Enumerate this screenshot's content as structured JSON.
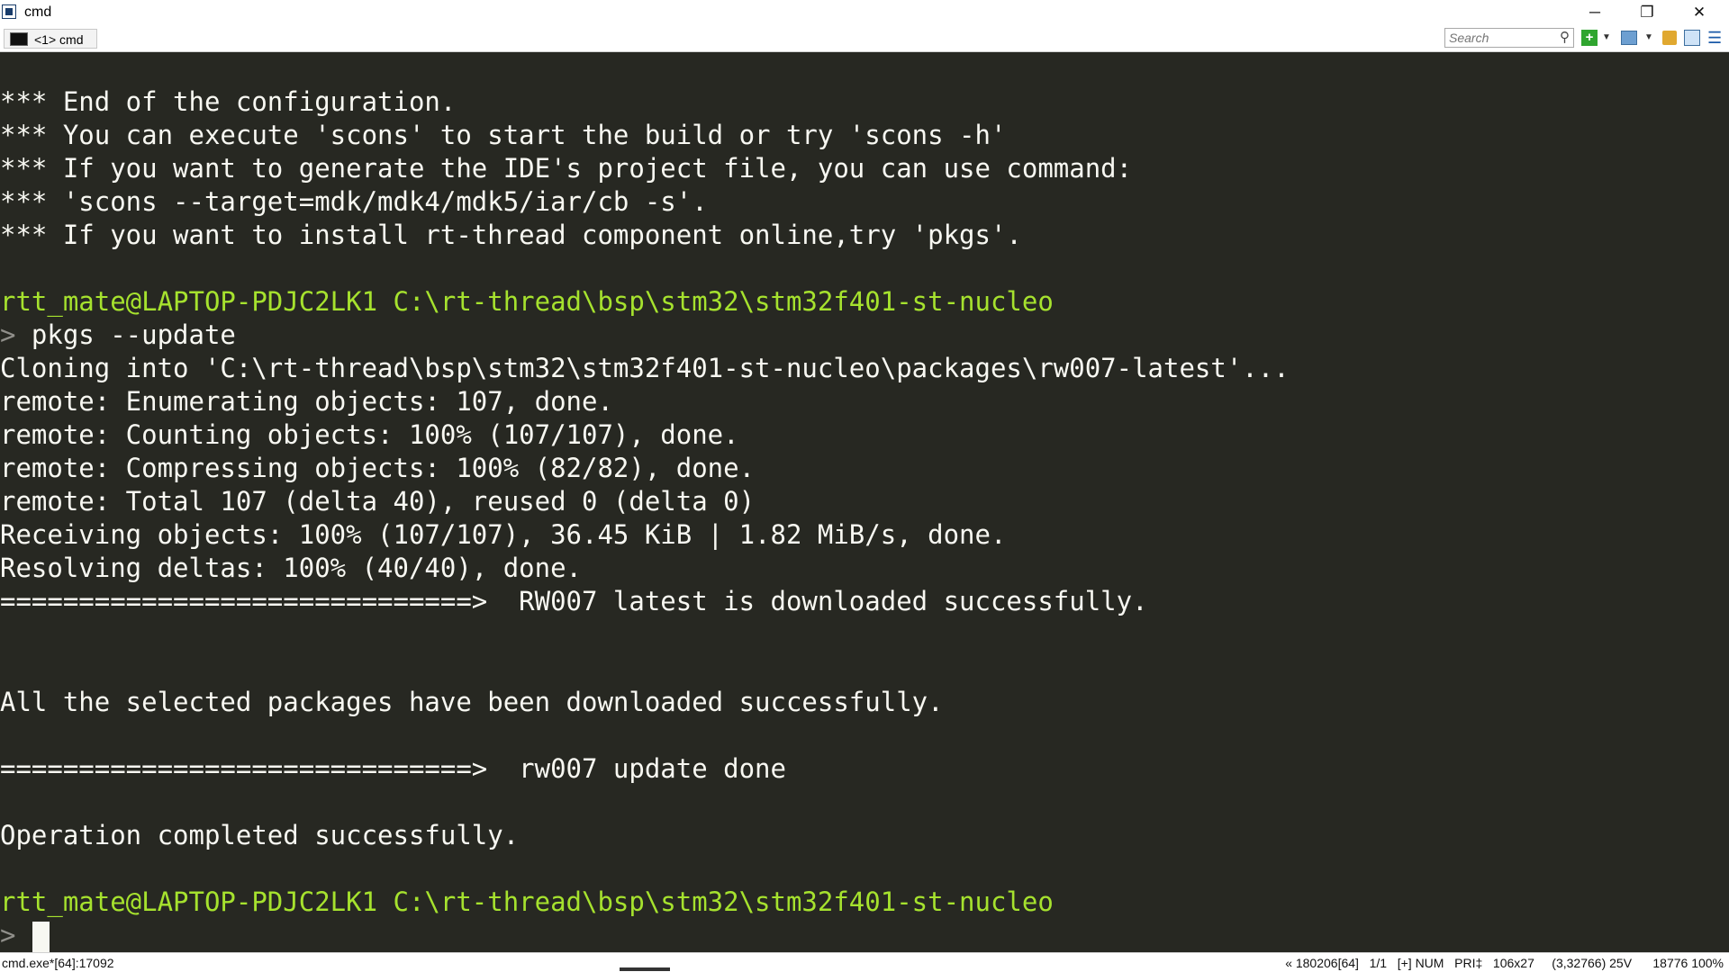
{
  "window": {
    "title": "cmd",
    "controls": {
      "minimize": "─",
      "maximize": "❐",
      "close": "✕"
    }
  },
  "tabs": [
    {
      "label": "<1> cmd"
    }
  ],
  "toolbar": {
    "search_placeholder": "Search",
    "search_icon": "⚲",
    "new_console": "+",
    "dropdown": "▼",
    "menu": "☰"
  },
  "terminal": {
    "lines": [
      {
        "text": "",
        "color": "default"
      },
      {
        "text": "*** End of the configuration.",
        "color": "default"
      },
      {
        "text": "*** You can execute 'scons' to start the build or try 'scons -h'",
        "color": "default"
      },
      {
        "text": "*** If you want to generate the IDE's project file, you can use command:",
        "color": "default"
      },
      {
        "text": "*** 'scons --target=mdk/mdk4/mdk5/iar/cb -s'.",
        "color": "default"
      },
      {
        "text": "*** If you want to install rt-thread component online,try 'pkgs'.",
        "color": "default"
      },
      {
        "text": "",
        "color": "default"
      },
      {
        "text": "rtt_mate@LAPTOP-PDJC2LK1 C:\\rt-thread\\bsp\\stm32\\stm32f401-st-nucleo",
        "color": "green"
      },
      {
        "prompt": "> ",
        "text": "pkgs --update",
        "color": "default"
      },
      {
        "text": "Cloning into 'C:\\rt-thread\\bsp\\stm32\\stm32f401-st-nucleo\\packages\\rw007-latest'...",
        "color": "default"
      },
      {
        "text": "remote: Enumerating objects: 107, done.",
        "color": "default"
      },
      {
        "text": "remote: Counting objects: 100% (107/107), done.",
        "color": "default"
      },
      {
        "text": "remote: Compressing objects: 100% (82/82), done.",
        "color": "default"
      },
      {
        "text": "remote: Total 107 (delta 40), reused 0 (delta 0)",
        "color": "default"
      },
      {
        "text": "Receiving objects: 100% (107/107), 36.45 KiB | 1.82 MiB/s, done.",
        "color": "default"
      },
      {
        "text": "Resolving deltas: 100% (40/40), done.",
        "color": "default"
      },
      {
        "text": "==============================>  RW007 latest is downloaded successfully.",
        "color": "default"
      },
      {
        "text": "",
        "color": "default"
      },
      {
        "text": "",
        "color": "default"
      },
      {
        "text": "All the selected packages have been downloaded successfully.",
        "color": "default"
      },
      {
        "text": "",
        "color": "default"
      },
      {
        "text": "==============================>  rw007 update done",
        "color": "default"
      },
      {
        "text": "",
        "color": "default"
      },
      {
        "text": "Operation completed successfully.",
        "color": "default"
      },
      {
        "text": "",
        "color": "default"
      },
      {
        "text": "rtt_mate@LAPTOP-PDJC2LK1 C:\\rt-thread\\bsp\\stm32\\stm32f401-st-nucleo",
        "color": "green"
      },
      {
        "prompt": ">",
        "text": "",
        "color": "default"
      }
    ]
  },
  "statusbar": {
    "left": "cmd.exe*[64]:17092",
    "right": "« 180206[64]   1/1   [+] NUM   PRI‡   106x27     (3,32766) 25V      18776 100%"
  },
  "colors": {
    "background": "#272822",
    "foreground": "#f8f8f2",
    "prompt_green": "#a6e22e",
    "prompt_arrow": "#908f8a"
  }
}
